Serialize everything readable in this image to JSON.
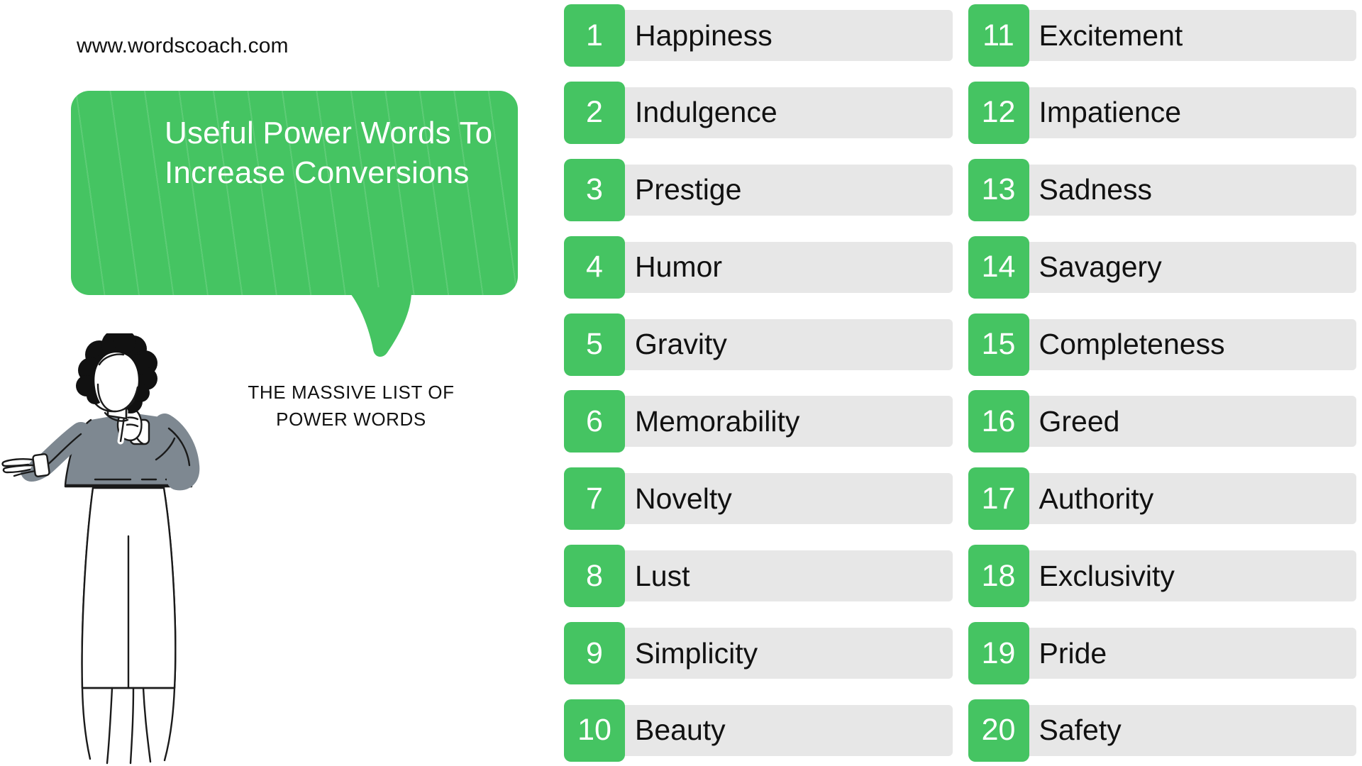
{
  "branding": {
    "site_url": "www.wordscoach.com"
  },
  "bubble": {
    "title": "Useful Power Words To Increase Conversions",
    "background_color": "#45c462",
    "text_color": "#ffffff"
  },
  "caption": {
    "line1": "THE MASSIVE LIST OF",
    "line2": "POWER WORDS"
  },
  "illustration": {
    "name": "woman-with-microphone",
    "hair_color": "#111111",
    "sweater_color": "#7e8891",
    "outline_color": "#1a1a1a"
  },
  "theme": {
    "accent_green": "#45c462",
    "row_background": "#e7e7e7",
    "page_background": "#ffffff",
    "text_color": "#111111",
    "badge_text_color": "#ffffff"
  },
  "list": {
    "columns": [
      {
        "items": [
          {
            "number": "1",
            "word": "Happiness"
          },
          {
            "number": "2",
            "word": "Indulgence"
          },
          {
            "number": "3",
            "word": "Prestige"
          },
          {
            "number": "4",
            "word": "Humor"
          },
          {
            "number": "5",
            "word": "Gravity"
          },
          {
            "number": "6",
            "word": "Memorability"
          },
          {
            "number": "7",
            "word": "Novelty"
          },
          {
            "number": "8",
            "word": "Lust"
          },
          {
            "number": "9",
            "word": "Simplicity"
          },
          {
            "number": "10",
            "word": "Beauty"
          }
        ]
      },
      {
        "items": [
          {
            "number": "11",
            "word": "Excitement"
          },
          {
            "number": "12",
            "word": "Impatience"
          },
          {
            "number": "13",
            "word": "Sadness"
          },
          {
            "number": "14",
            "word": "Savagery"
          },
          {
            "number": "15",
            "word": "Completeness"
          },
          {
            "number": "16",
            "word": "Greed"
          },
          {
            "number": "17",
            "word": "Authority"
          },
          {
            "number": "18",
            "word": "Exclusivity"
          },
          {
            "number": "19",
            "word": "Pride"
          },
          {
            "number": "20",
            "word": "Safety"
          }
        ]
      }
    ]
  }
}
